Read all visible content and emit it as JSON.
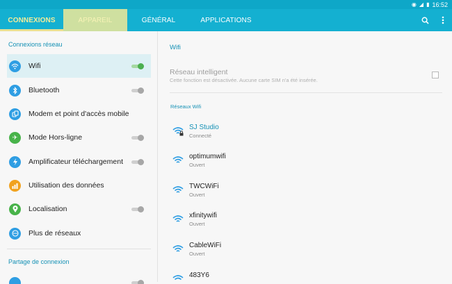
{
  "status_bar": {
    "time": "16:52"
  },
  "tabs": [
    {
      "label": "CONNEXIONS"
    },
    {
      "label": "APPAREIL"
    },
    {
      "label": "GÉNÉRAL"
    },
    {
      "label": "APPLICATIONS"
    }
  ],
  "left": {
    "section1": "Connexions réseau",
    "items": [
      {
        "label": "Wifi",
        "icon": "wifi-icon",
        "color": "#2f9ee3",
        "toggle": "on"
      },
      {
        "label": "Bluetooth",
        "icon": "bluetooth-icon",
        "color": "#2f9ee3",
        "toggle": "off"
      },
      {
        "label": "Modem et point d'accès mobile",
        "icon": "hotspot-icon",
        "color": "#2f9ee3"
      },
      {
        "label": "Mode Hors-ligne",
        "icon": "airplane-icon",
        "color": "#48b34a",
        "toggle": "off"
      },
      {
        "label": "Amplificateur téléchargement",
        "icon": "download-booster-icon",
        "color": "#2f9ee3",
        "toggle": "off"
      },
      {
        "label": "Utilisation des données",
        "icon": "data-usage-icon",
        "color": "#f1a21e"
      },
      {
        "label": "Localisation",
        "icon": "location-icon",
        "color": "#48b34a",
        "toggle": "off"
      },
      {
        "label": "Plus de réseaux",
        "icon": "more-networks-icon",
        "color": "#2f9ee3"
      }
    ],
    "section2": "Partage de connexion"
  },
  "right": {
    "header": "Wifi",
    "smart_title": "Réseau intelligent",
    "smart_sub": "Cette fonction est désactivée. Aucune carte SIM n'a été insérée.",
    "networks_header": "Réseaux Wifi",
    "networks": [
      {
        "name": "SJ Studio",
        "status": "Connecté",
        "locked": true
      },
      {
        "name": "optimumwifi",
        "status": "Ouvert",
        "locked": false
      },
      {
        "name": "TWCWiFi",
        "status": "Ouvert",
        "locked": false
      },
      {
        "name": "xfinitywifi",
        "status": "Ouvert",
        "locked": false
      },
      {
        "name": "CableWiFi",
        "status": "Ouvert",
        "locked": false
      },
      {
        "name": "483Y6",
        "status": "",
        "locked": false
      }
    ]
  }
}
